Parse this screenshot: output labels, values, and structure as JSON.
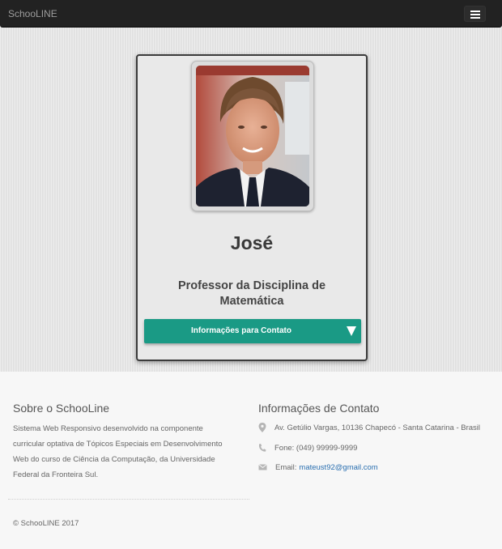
{
  "navbar": {
    "brand": "SchooLINE"
  },
  "profile": {
    "name": "José",
    "role": "Professor da Disciplina de Matemática",
    "contact_button_label": "Informações para Contato"
  },
  "footer": {
    "about_title": "Sobre o SchooLine",
    "about_text": "Sistema Web Responsivo desenvolvido na componente curricular optativa de Tópicos Especiais em Desenvolvimento Web do curso de Ciência da Computação, da Universidade Federal da Fronteira Sul.",
    "contact_title": "Informações de Contato",
    "address": "Av. Getúlio Vargas, 10136 Chapecó - Santa Catarina - Brasil",
    "phone": "Fone: (049) 99999-9999",
    "email_label": "Email:",
    "email": "mateust92@gmail.com",
    "copyright": "© SchooLINE 2017"
  },
  "colors": {
    "navbar": "#222222",
    "accent": "#1a9a85",
    "link": "#2a6fb0"
  },
  "icons": [
    "menu-icon",
    "map-marker-icon",
    "phone-icon",
    "envelope-icon",
    "caret-down-icon"
  ]
}
